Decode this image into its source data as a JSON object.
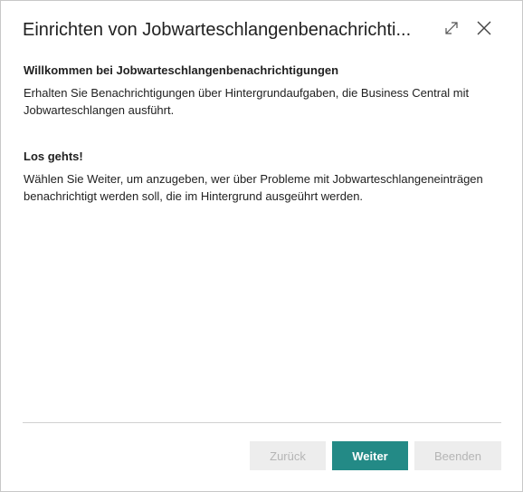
{
  "dialog": {
    "title": "Einrichten von Jobwarteschlangenbenachrichti...",
    "expand_icon": "expand-diagonal-arrows-icon",
    "close_icon": "close-x-icon"
  },
  "content": {
    "welcome_heading": "Willkommen bei Jobwarteschlangenbenachrichtigungen",
    "welcome_text": "Erhalten Sie Benachrichtigungen über Hintergrundaufgaben, die Business Central mit Jobwarteschlangen ausführt.",
    "start_heading": "Los gehts!",
    "start_text": "Wählen Sie Weiter, um anzugeben, wer über Probleme mit Jobwarteschlangeneinträgen benachrichtigt werden soll, die im Hintergrund ausgeührt werden."
  },
  "footer": {
    "back_label": "Zurück",
    "next_label": "Weiter",
    "finish_label": "Beenden"
  },
  "colors": {
    "primary": "#238a86",
    "disabled_bg": "#ededed",
    "disabled_text": "#b5b5b5"
  }
}
